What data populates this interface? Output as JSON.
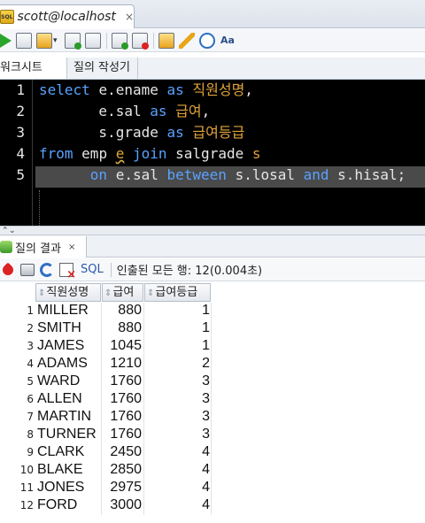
{
  "document_tab": {
    "title": "scott@localhost",
    "close": "×",
    "icon": "sql-file-icon"
  },
  "toolbar": {
    "icons": [
      "run-statement-icon",
      "run-script-icon",
      "autotrace-icon",
      "explain-plan-icon",
      "sql-tuning-icon",
      "commit-icon",
      "rollback-icon",
      "unshared-sql-icon",
      "clear-icon",
      "sql-history-icon",
      "format-case-icon"
    ]
  },
  "editor_tabs": [
    "워크시트",
    "질의 작성기"
  ],
  "editor": {
    "line_numbers": [
      "1",
      "2",
      "3",
      "4",
      "5"
    ],
    "lines": [
      [
        {
          "t": "select ",
          "c": "kw"
        },
        {
          "t": "e.ename ",
          "c": "id"
        },
        {
          "t": "as ",
          "c": "kw"
        },
        {
          "t": "직원성명",
          "c": "kr"
        },
        {
          "t": ",",
          "c": "id"
        }
      ],
      [
        {
          "t": "       e.sal ",
          "c": "id"
        },
        {
          "t": "as ",
          "c": "kw"
        },
        {
          "t": "급여",
          "c": "kr"
        },
        {
          "t": ",",
          "c": "id"
        }
      ],
      [
        {
          "t": "       s.grade ",
          "c": "id"
        },
        {
          "t": "as ",
          "c": "kw"
        },
        {
          "t": "급여등급",
          "c": "kr"
        }
      ],
      [
        {
          "t": "from ",
          "c": "kw"
        },
        {
          "t": "emp ",
          "c": "id"
        },
        {
          "t": "e",
          "c": "sq"
        },
        {
          "t": " ",
          "c": "id"
        },
        {
          "t": "join ",
          "c": "kw"
        },
        {
          "t": "salgrade ",
          "c": "id"
        },
        {
          "t": "s",
          "c": "kr"
        }
      ],
      [
        {
          "t": "      on ",
          "c": "kw"
        },
        {
          "t": "e.sal ",
          "c": "id"
        },
        {
          "t": "between ",
          "c": "kw"
        },
        {
          "t": "s.losal ",
          "c": "id"
        },
        {
          "t": "and ",
          "c": "kw"
        },
        {
          "t": "s.hisal;",
          "c": "id"
        }
      ]
    ]
  },
  "results_tab": {
    "label": "질의 결과",
    "close": "×"
  },
  "results_toolbar": {
    "sql_label": "SQL",
    "status": "인출된 모든 행: 12(0.004초)"
  },
  "grid": {
    "columns": [
      "직원성명",
      "급여",
      "급여등급"
    ],
    "sort_glyph": "⇕",
    "rows": [
      {
        "rn": "1",
        "name": "MILLER",
        "sal": "880",
        "grade": "1"
      },
      {
        "rn": "2",
        "name": "SMITH",
        "sal": "880",
        "grade": "1"
      },
      {
        "rn": "3",
        "name": "JAMES",
        "sal": "1045",
        "grade": "1"
      },
      {
        "rn": "4",
        "name": "ADAMS",
        "sal": "1210",
        "grade": "2"
      },
      {
        "rn": "5",
        "name": "WARD",
        "sal": "1760",
        "grade": "3"
      },
      {
        "rn": "6",
        "name": "ALLEN",
        "sal": "1760",
        "grade": "3"
      },
      {
        "rn": "7",
        "name": "MARTIN",
        "sal": "1760",
        "grade": "3"
      },
      {
        "rn": "8",
        "name": "TURNER",
        "sal": "1760",
        "grade": "3"
      },
      {
        "rn": "9",
        "name": "CLARK",
        "sal": "2450",
        "grade": "4"
      },
      {
        "rn": "10",
        "name": "BLAKE",
        "sal": "2850",
        "grade": "4"
      },
      {
        "rn": "11",
        "name": "JONES",
        "sal": "2975",
        "grade": "4"
      },
      {
        "rn": "12",
        "name": "FORD",
        "sal": "3000",
        "grade": "4"
      }
    ]
  },
  "colors": {
    "keyword": "#5aa2ff",
    "korean_alias": "#e0a43a",
    "editor_bg": "#000000",
    "current_line": "#4a4a4a"
  }
}
